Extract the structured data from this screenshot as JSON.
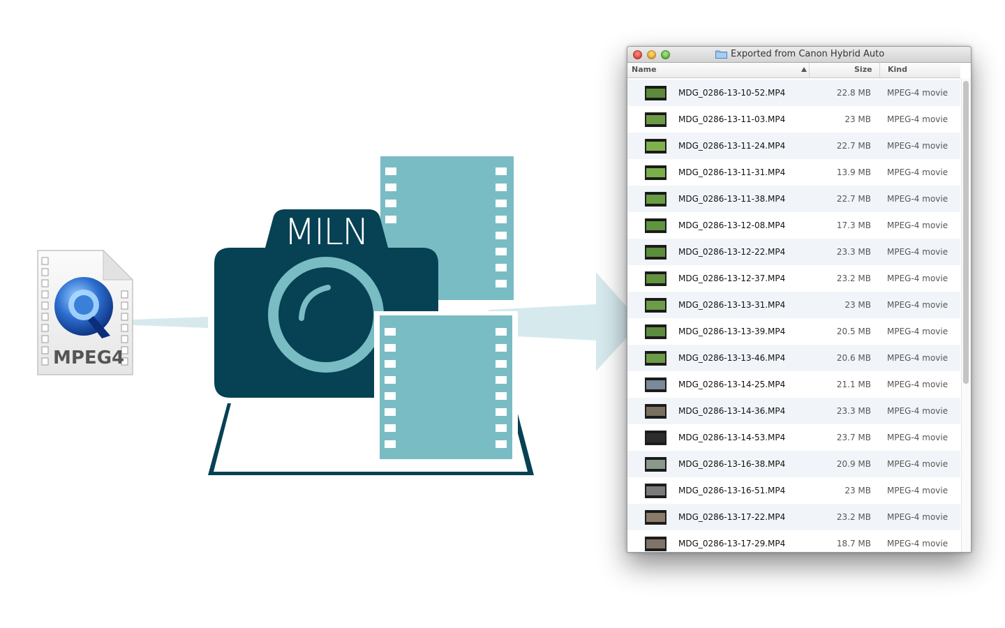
{
  "file_icon": {
    "icon": "quicktime-mpeg4-file-icon",
    "label": "MPEG4"
  },
  "logo": {
    "text": "MILN",
    "icon": "camera-with-film-strips-icon"
  },
  "colors": {
    "dark_teal": "#064154",
    "light_teal": "#7abcc4",
    "arrow": "#d6eaee"
  },
  "window": {
    "title": "Exported from Canon Hybrid Auto",
    "columns": {
      "name": "Name",
      "size": "Size",
      "kind": "Kind"
    },
    "sort_indicator": "sort-ascending-icon",
    "files": [
      {
        "name": "MDG_0286-13-10-52.MP4",
        "size": "22.8 MB",
        "kind": "MPEG-4 movie",
        "thumb": "#5c8a3a"
      },
      {
        "name": "MDG_0286-13-11-03.MP4",
        "size": "23 MB",
        "kind": "MPEG-4 movie",
        "thumb": "#6f9a45"
      },
      {
        "name": "MDG_0286-13-11-24.MP4",
        "size": "22.7 MB",
        "kind": "MPEG-4 movie",
        "thumb": "#7fb24c"
      },
      {
        "name": "MDG_0286-13-11-31.MP4",
        "size": "13.9 MB",
        "kind": "MPEG-4 movie",
        "thumb": "#7cae4a"
      },
      {
        "name": "MDG_0286-13-11-38.MP4",
        "size": "22.7 MB",
        "kind": "MPEG-4 movie",
        "thumb": "#6a9c44"
      },
      {
        "name": "MDG_0286-13-12-08.MP4",
        "size": "17.3 MB",
        "kind": "MPEG-4 movie",
        "thumb": "#5f9440"
      },
      {
        "name": "MDG_0286-13-12-22.MP4",
        "size": "23.3 MB",
        "kind": "MPEG-4 movie",
        "thumb": "#5b8d3c"
      },
      {
        "name": "MDG_0286-13-12-37.MP4",
        "size": "23.2 MB",
        "kind": "MPEG-4 movie",
        "thumb": "#64923f"
      },
      {
        "name": "MDG_0286-13-13-31.MP4",
        "size": "23 MB",
        "kind": "MPEG-4 movie",
        "thumb": "#6b9c47"
      },
      {
        "name": "MDG_0286-13-13-39.MP4",
        "size": "20.5 MB",
        "kind": "MPEG-4 movie",
        "thumb": "#5e8c3f"
      },
      {
        "name": "MDG_0286-13-13-46.MP4",
        "size": "20.6 MB",
        "kind": "MPEG-4 movie",
        "thumb": "#6c9b48"
      },
      {
        "name": "MDG_0286-13-14-25.MP4",
        "size": "21.1 MB",
        "kind": "MPEG-4 movie",
        "thumb": "#7a8a9a"
      },
      {
        "name": "MDG_0286-13-14-36.MP4",
        "size": "23.3 MB",
        "kind": "MPEG-4 movie",
        "thumb": "#7a6f60"
      },
      {
        "name": "MDG_0286-13-14-53.MP4",
        "size": "23.7 MB",
        "kind": "MPEG-4 movie",
        "thumb": "#2c2c2c"
      },
      {
        "name": "MDG_0286-13-16-38.MP4",
        "size": "20.9 MB",
        "kind": "MPEG-4 movie",
        "thumb": "#8a9a8a"
      },
      {
        "name": "MDG_0286-13-16-51.MP4",
        "size": "23 MB",
        "kind": "MPEG-4 movie",
        "thumb": "#7a7a7a"
      },
      {
        "name": "MDG_0286-13-17-22.MP4",
        "size": "23.2 MB",
        "kind": "MPEG-4 movie",
        "thumb": "#8a7a6a"
      },
      {
        "name": "MDG_0286-13-17-29.MP4",
        "size": "18.7 MB",
        "kind": "MPEG-4 movie",
        "thumb": "#7e7468"
      }
    ]
  }
}
